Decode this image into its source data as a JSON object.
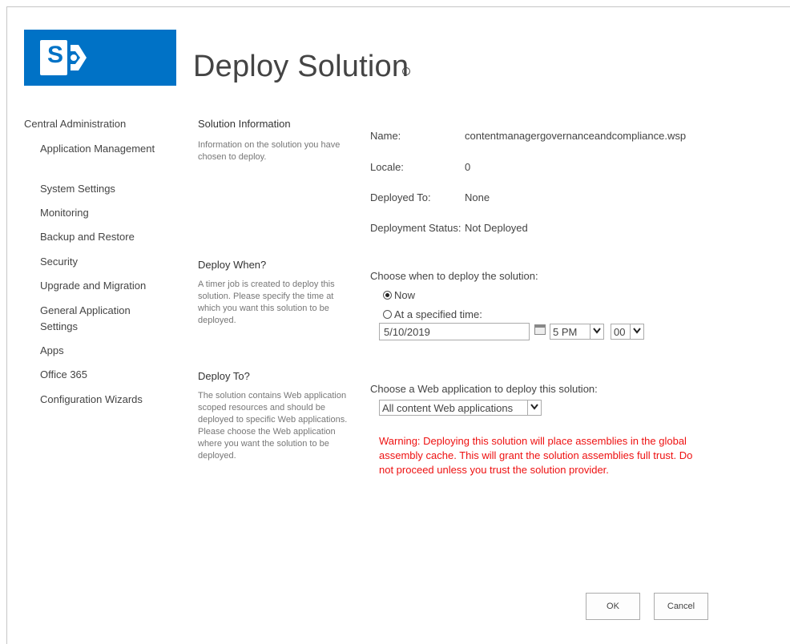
{
  "header": {
    "title": "Deploy Solution",
    "info_glyph": "i",
    "logo_letter": "S",
    "brand_color": "#0072c6"
  },
  "nav": {
    "root": "Central Administration",
    "items": [
      "Application Management",
      "System Settings",
      "Monitoring",
      "Backup and Restore",
      "Security",
      "Upgrade and Migration",
      "General Application Settings",
      "Apps",
      "Office 365",
      "Configuration Wizards"
    ]
  },
  "sections": {
    "solution_info": {
      "title": "Solution Information",
      "desc": "Information on the solution you have chosen to deploy."
    },
    "deploy_when": {
      "title": "Deploy When?",
      "desc": "A timer job is created to deploy this solution. Please specify the time at which you want this solution to be deployed."
    },
    "deploy_to": {
      "title": "Deploy To?",
      "desc": "The solution contains Web application scoped resources and should be deployed to specific Web applications. Please choose the Web application where you want the solution to be deployed."
    }
  },
  "fields": {
    "name_label": "Name:",
    "name_value": "contentmanagergovernanceandcompliance.wsp",
    "locale_label": "Locale:",
    "locale_value": "0",
    "deployed_to_label": "Deployed To:",
    "deployed_to_value": "None",
    "status_label": "Deployment Status:",
    "status_value": "Not Deployed"
  },
  "deploy_when": {
    "prompt": "Choose when to deploy the solution:",
    "option_now": "Now",
    "option_specified": "At a specified time:",
    "selected": "now",
    "date_value": "5/10/2019",
    "hour_value": "5 PM",
    "minute_value": "00"
  },
  "deploy_to": {
    "prompt": "Choose a Web application to deploy this solution:",
    "selected_app": "All content Web applications",
    "warning": "Warning: Deploying this solution will place assemblies in the global assembly cache. This will grant the solution assemblies full trust. Do not proceed unless you trust the solution provider.",
    "warning_color": "#e11111"
  },
  "buttons": {
    "ok": "OK",
    "cancel": "Cancel"
  }
}
